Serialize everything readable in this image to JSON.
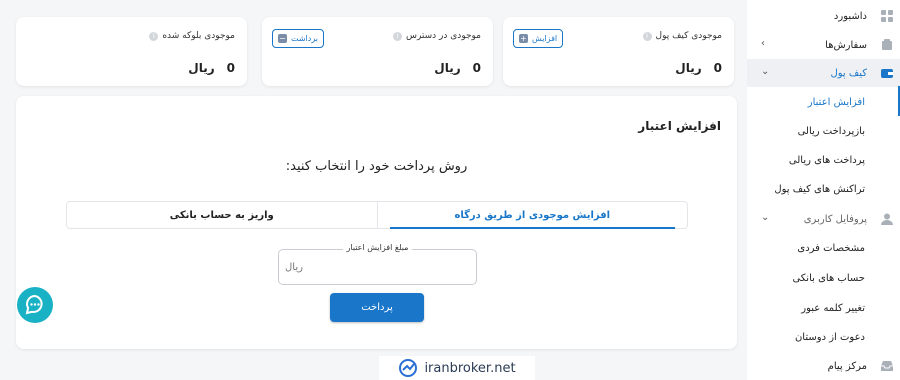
{
  "cards": [
    {
      "title": "موجودی کیف پول",
      "button": "افزایش",
      "button_icon": "+",
      "amount": "0",
      "unit": "ریال"
    },
    {
      "title": "موجودی در دسترس",
      "button": "برداشت",
      "button_icon": "−",
      "amount": "0",
      "unit": "ریال"
    },
    {
      "title": "موجودی بلوکه شده",
      "amount": "0",
      "unit": "ریال"
    }
  ],
  "panel": {
    "title": "افزایش اعتبار",
    "prompt": "روش پرداخت خود را انتخاب کنید:",
    "tabs": {
      "gateway": "افزایش موجودی از طریق درگاه",
      "bank": "واریز به حساب بانکی"
    },
    "amount_label": "مبلغ افزایش اعتبار",
    "amount_placeholder": "ریال",
    "pay_button": "پرداخت"
  },
  "sidebar": {
    "dashboard": "داشبورد",
    "orders": "سفارش‌ها",
    "wallet": "کیف پول",
    "wallet_items": [
      "افزایش اعتبار",
      "بازپرداخت ریالی",
      "پرداخت های ریالی",
      "تراکنش های کیف پول"
    ],
    "profile": "پروفایل کاربری",
    "profile_items": [
      "مشخصات فردی",
      "حساب های بانکی",
      "تغییر کلمه عبور",
      "دعوت از دوستان"
    ],
    "messages": "مرکز پیام"
  },
  "watermark": "iranbroker.net",
  "colors": {
    "accent": "#1976c8",
    "chat": "#19b1c4"
  }
}
